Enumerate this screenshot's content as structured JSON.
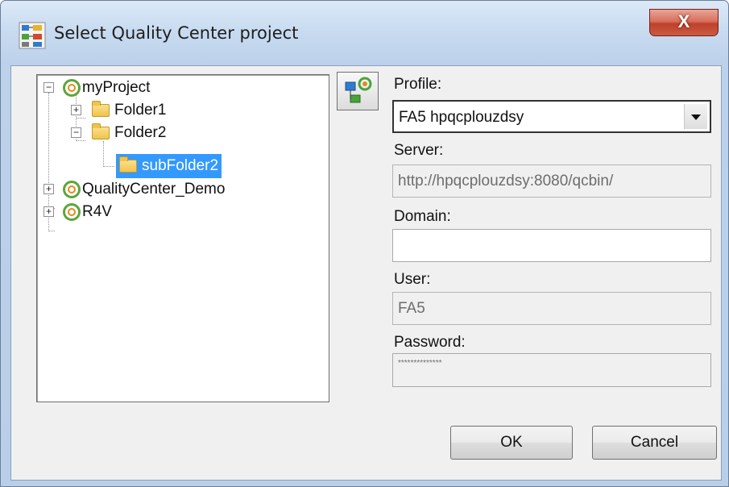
{
  "window": {
    "title": "Select Quality Center project",
    "close_label": "X"
  },
  "tree": {
    "items": [
      {
        "label": "myProject",
        "icon": "qc-project-icon",
        "expanded": true
      },
      {
        "label": "Folder1",
        "icon": "folder-icon",
        "expanded": false
      },
      {
        "label": "Folder2",
        "icon": "folder-icon",
        "expanded": true
      },
      {
        "label": "subFolder2",
        "icon": "folder-icon",
        "selected": true
      },
      {
        "label": "QualityCenter_Demo",
        "icon": "qc-project-icon",
        "expanded": false
      },
      {
        "label": "R4V",
        "icon": "qc-project-icon",
        "expanded": false
      }
    ]
  },
  "form": {
    "profile_label": "Profile:",
    "profile_value": "FA5 hpqcplouzdsy",
    "server_label": "Server:",
    "server_value": "http://hpqcplouzdsy:8080/qcbin/",
    "domain_label": "Domain:",
    "domain_value": "",
    "user_label": "User:",
    "user_value": "FA5",
    "password_label": "Password:",
    "password_value": "**************"
  },
  "buttons": {
    "ok": "OK",
    "cancel": "Cancel"
  },
  "colors": {
    "selection": "#3399ff",
    "close_button": "#c94a36"
  }
}
